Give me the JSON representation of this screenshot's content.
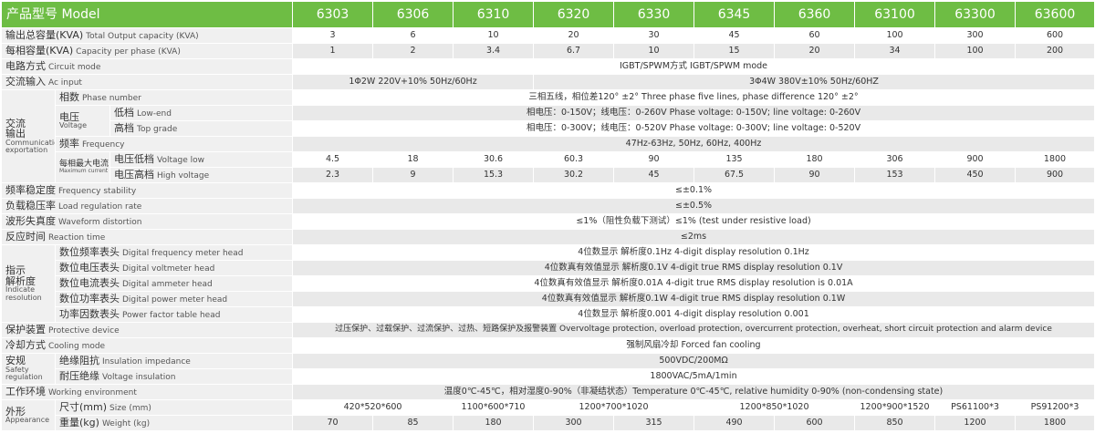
{
  "header": {
    "label": "产品型号 Model",
    "models": [
      "6303",
      "6306",
      "6310",
      "6320",
      "6330",
      "6345",
      "6360",
      "63100",
      "63300",
      "63600"
    ]
  },
  "rows": {
    "total_capacity": {
      "zh": "输出总容量(KVA)",
      "en": "Total Output capacity (KVA)",
      "values": [
        "3",
        "6",
        "10",
        "20",
        "30",
        "45",
        "60",
        "100",
        "300",
        "600"
      ]
    },
    "phase_capacity": {
      "zh": "每相容量(KVA)",
      "en": "Capacity per phase (KVA)",
      "values": [
        "1",
        "2",
        "3.4",
        "6.7",
        "10",
        "15",
        "20",
        "34",
        "100",
        "200"
      ]
    },
    "circuit_mode": {
      "zh": "电路方式",
      "en": "Circuit mode",
      "value": "IGBT/SPWM方式 IGBT/SPWM mode"
    },
    "ac_input": {
      "zh": "交流输入",
      "en": "Ac input",
      "v1": "1Φ2W 220V+10%  50Hz/60Hz",
      "v2": "3Φ4W  380V±10%   50Hz/60HZ"
    },
    "ac_output": {
      "cat_zh1": "交流",
      "cat_zh2": "输出",
      "cat_en1": "Communication",
      "cat_en2": "exportation",
      "phase_number": {
        "zh": "相数",
        "en": "Phase number",
        "value": "三相五线，相位差120° ±2°  Three phase five lines, phase difference 120° ±2°"
      },
      "voltage": {
        "zh": "电压",
        "en": "Voltage"
      },
      "low_end": {
        "zh": "低档",
        "en": "Low-end",
        "value": "相电压：0-150V；线电压：0-260V  Phase voltage: 0-150V; line voltage: 0-260V"
      },
      "top_grade": {
        "zh": "高档",
        "en": "Top grade",
        "value": "相电压：0-300V；线电压：0-520V  Phase voltage: 0-300V; line voltage: 0-520V"
      },
      "frequency": {
        "zh": "频率",
        "en": "Frequency",
        "value": "47Hz-63Hz, 50Hz, 60Hz, 400Hz"
      },
      "max_current": {
        "zh": "每相最大电流",
        "en": "Maximum current per phase"
      },
      "voltage_low": {
        "zh": "电压低档",
        "en": "Voltage low",
        "values": [
          "4.5",
          "18",
          "30.6",
          "60.3",
          "90",
          "135",
          "180",
          "306",
          "900",
          "1800"
        ]
      },
      "high_voltage": {
        "zh": "电压高档",
        "en": "High voltage",
        "values": [
          "2.3",
          "9",
          "15.3",
          "30.2",
          "45",
          "67.5",
          "90",
          "153",
          "450",
          "900"
        ]
      }
    },
    "freq_stability": {
      "zh": "频率稳定度",
      "en": "Frequency stability",
      "value": "≤±0.1%"
    },
    "load_regulation": {
      "zh": "负载稳压率",
      "en": "Load regulation rate",
      "value": "≤±0.5%"
    },
    "waveform": {
      "zh": "波形失真度",
      "en": "Waveform distortion",
      "value": "≤1%（阻性负载下测试）≤1% (test under resistive load)"
    },
    "reaction_time": {
      "zh": "反应时间",
      "en": "Reaction time",
      "value": "≤2ms"
    },
    "indicate": {
      "cat_zh1": "指示",
      "cat_zh2": "解析度",
      "cat_en1": "Indicate",
      "cat_en2": "resolution",
      "freq_meter": {
        "zh": "数位频率表头",
        "en": "Digital frequency meter head",
        "value": "4位数显示  解析度0.1Hz  4-digit display resolution 0.1Hz"
      },
      "voltmeter": {
        "zh": "数位电压表头",
        "en": "Digital voltmeter head",
        "value": "4位数真有效值显示  解析度0.1V  4-digit true RMS display resolution 0.1V"
      },
      "ammeter": {
        "zh": "数位电流表头",
        "en": "Digital ammeter head",
        "value": "4位数真有效值显示  解析度0.01A  4-digit true RMS display resolution is 0.01A"
      },
      "power_meter": {
        "zh": "数位功率表头",
        "en": "Digital power meter head",
        "value": "4位数真有效值显示  解析度0.1W  4-digit true RMS display resolution 0.1W"
      },
      "pf_meter": {
        "zh": "功率因数表头",
        "en": "Power factor table head",
        "value": "4位数显示  解析度0.001  4-digit display resolution 0.001"
      }
    },
    "protective": {
      "zh": "保护装置",
      "en": "Protective device",
      "value": "过压保护、过载保护、过流保护、过热、短路保护及报警装置  Overvoltage protection, overload protection, overcurrent protection, overheat, short circuit protection and alarm device"
    },
    "cooling": {
      "zh": "冷却方式",
      "en": "Cooling mode",
      "value": "强制风扇冷却  Forced fan cooling"
    },
    "safety": {
      "cat_zh": "安规",
      "cat_en1": "Safety",
      "cat_en2": "regulation",
      "insulation_imp": {
        "zh": "绝缘阻抗",
        "en": "Insulation impedance",
        "value": "500VDC/200MΩ"
      },
      "insulation_volt": {
        "zh": "耐压绝缘",
        "en": "Voltage insulation",
        "value": "1800VAC/5mA/1min"
      }
    },
    "environment": {
      "zh": "工作环境",
      "en": "Working environment",
      "value": "温度0℃-45℃，相对湿度0-90%（非凝结状态）Temperature 0℃-45℃, relative humidity 0-90% (non-condensing state)"
    },
    "appearance": {
      "cat_zh": "外形",
      "cat_en": "Appearance",
      "size": {
        "zh": "尺寸(mm)",
        "en": "Size (mm)",
        "v1": "420*520*600",
        "v2": "1100*600*710",
        "v3": "1200*700*1020",
        "v4": "1200*850*1020",
        "v5": "1200*900*1520",
        "v6": "PS61100*3",
        "v7": "PS91200*3"
      },
      "weight": {
        "zh": "重量(kg)",
        "en": "Weight (kg)",
        "values": [
          "70",
          "85",
          "180",
          "300",
          "315",
          "490",
          "600",
          "850",
          "1200",
          "1800"
        ]
      }
    }
  }
}
